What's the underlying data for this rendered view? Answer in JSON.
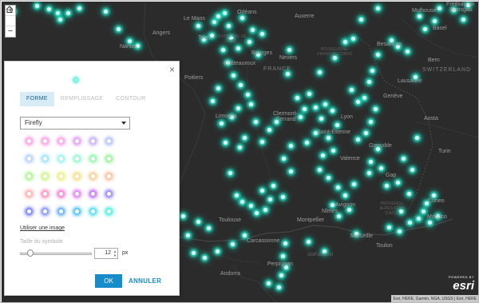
{
  "map": {
    "countries": {
      "france": "FRANCE",
      "switzerland": "SWITZERLAND"
    },
    "places": {
      "orleans": "Orléans",
      "auxerre": "Auxerre",
      "mulhouse": "Mulhouse",
      "freiburg1": "Freiburg im",
      "freiburg2": "Breisgau",
      "basel": "Basel",
      "angers": "Angers",
      "tours": "Tours",
      "nantes": "Nantes",
      "le_mans": "Le Mans",
      "bourges": "Bourges",
      "nevers": "Nevers",
      "besancon": "Besançon",
      "bern": "Bern",
      "chateauroux": "Châteauroux",
      "poitiers": "Poitiers",
      "lausanne": "Lausanne",
      "geneve": "Genève",
      "limoges": "Limoges",
      "clermont1": "Clermont-",
      "clermont2": "Ferrand",
      "lyon": "Lyon",
      "aosta": "Aosta",
      "saint_etienne": "Saint-Étienne",
      "grenoble": "Grenoble",
      "turin": "Turin",
      "valence": "Valence",
      "gap": "Gap",
      "cuneo": "Cuneo",
      "nimes": "Nîmes",
      "avignon": "Avignon",
      "toulouse": "Toulouse",
      "montpellier": "Montpellier",
      "monaco": "Monaco",
      "marseille": "Marseille",
      "carcassonne": "Carcassonne",
      "toulon": "Toulon",
      "andorra": "Andorra",
      "perpignan": "Perpignan"
    },
    "regions": {
      "centre": "CENTRE-VAL DE LOIRE",
      "bourgogne": "BOURGOGNE-FRANCHE-COMTÉ",
      "paca": "PROVENCE-ALPES-CÔTE D'AZUR"
    },
    "sea": "Golf du Lion",
    "attribution": "Esri, HERE, Garmin, NGA, USGS | Esri, HERE",
    "logo_top": "POWERED BY",
    "logo": "esri",
    "zoom_in": "+",
    "zoom_out": "−",
    "home_icon": "home-icon",
    "point_glow_color": "#37ead0",
    "point_core_color": "#dcfffa"
  },
  "panel": {
    "close": "×",
    "tabs": {
      "forme": "FORME",
      "remplissage": "REMPLISSAGE",
      "contour": "CONTOUR"
    },
    "style_select": "Firefly",
    "swatch_colors": [
      "#f7a8e7",
      "#f7a8e7",
      "#f7a8e7",
      "#e2a4f4",
      "#c8b6f9",
      "#b8c7fa",
      "#bcd3fb",
      "#a7e5fb",
      "#a7f3ef",
      "#a2f6d4",
      "#9ff7b5",
      "#a5f3a0",
      "#b3f59a",
      "#d1f594",
      "#ecf08b",
      "#f4e191",
      "#f7d2a0",
      "#fbc5a7",
      "#fbb6b3",
      "#f99bc3",
      "#f48bd7",
      "#e08cf2",
      "#c87ff5",
      "#a28ff6",
      "#7f8af5",
      "#8d9cf3",
      "#74b4f2",
      "#5ec6f6",
      "#5ce1f0",
      "#5af1e1"
    ],
    "link": "Utiliser une image",
    "size_label": "Taille du symbole",
    "size_value": "12",
    "size_fraction": 0.1,
    "unit": "px",
    "ok": "OK",
    "cancel": "ANNULER",
    "accent": "#168cc8"
  }
}
